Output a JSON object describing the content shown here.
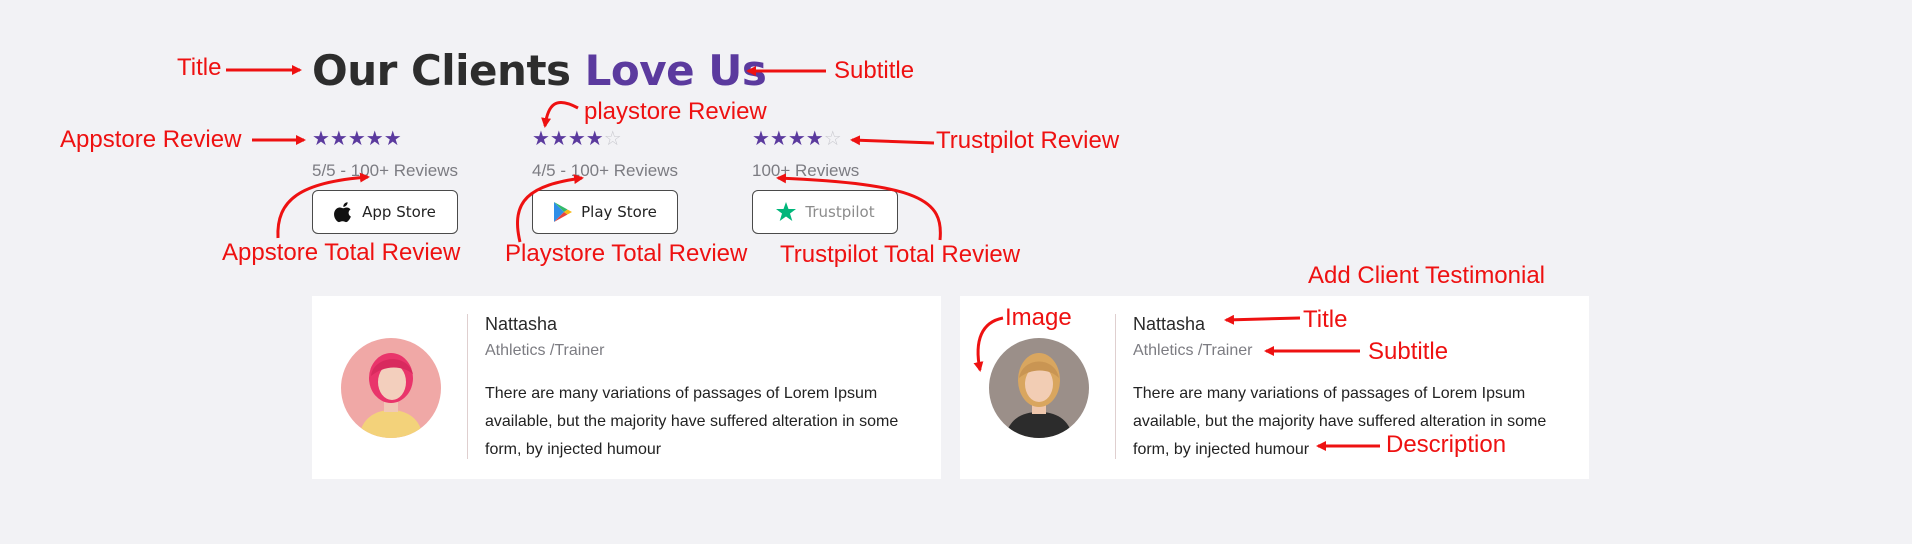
{
  "heading": {
    "title": "Our Clients",
    "subtitle": "Love Us"
  },
  "ratings": [
    {
      "stars": "★★★★★",
      "stars_off": "",
      "rating": 5,
      "reviews": "5/5 - 100+ Reviews",
      "button": "App Store",
      "icon": "apple-icon"
    },
    {
      "stars": "★★★★",
      "stars_off": "☆",
      "rating": 4,
      "reviews": "4/5 - 100+ Reviews",
      "button": "Play Store",
      "icon": "play-store-icon"
    },
    {
      "stars": "★★★★",
      "stars_off": "☆",
      "rating": 4,
      "reviews": "100+ Reviews",
      "button": "Trustpilot",
      "icon": "trustpilot-star-icon"
    }
  ],
  "testimonials": [
    {
      "name": "Nattasha",
      "role": "Athletics /Trainer",
      "text": "There are many variations of passages of Lorem Ipsum available, but the majority have suffered alteration in some form, by injected humour"
    },
    {
      "name": "Nattasha",
      "role": "Athletics /Trainer",
      "text": "There are many variations of passages of Lorem Ipsum available, but the majority have suffered alteration in some form, by injected humour"
    }
  ],
  "annotations": {
    "title": "Title",
    "subtitle": "Subtitle",
    "appstore_review": "Appstore Review",
    "playstore_review": "playstore Review",
    "trustpilot_review": "Trustpilot Review",
    "appstore_total": "Appstore Total Review",
    "playstore_total": "Playstore Total Review",
    "trustpilot_total": "Trustpilot Total Review",
    "add_testimonial": "Add Client Testimonial",
    "image": "Image",
    "card_title": "Title",
    "card_subtitle": "Subtitle",
    "description": "Description"
  },
  "colors": {
    "accent": "#5b3a9e",
    "annotation": "#ee1111",
    "background": "#f2f2f5"
  }
}
